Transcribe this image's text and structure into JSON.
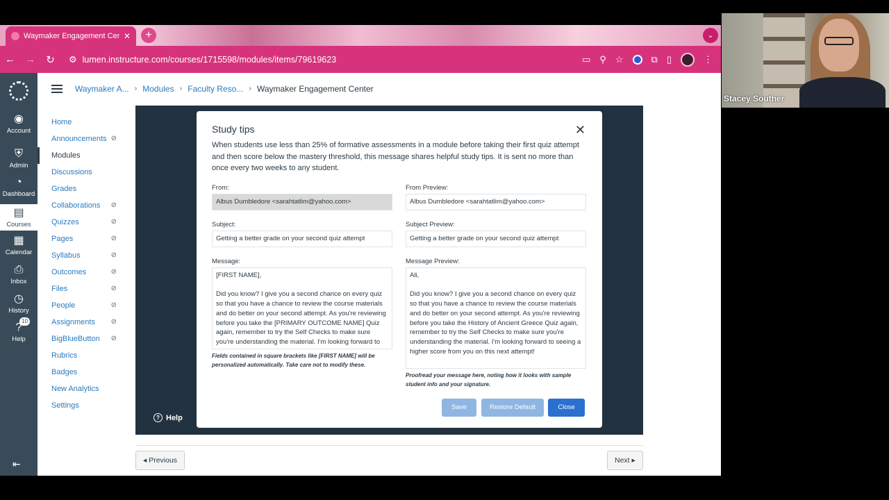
{
  "browser": {
    "tab_title": "Waymaker Engagement Cente",
    "url": "lumen.instructure.com/courses/1715598/modules/items/79619623"
  },
  "global_nav": [
    {
      "label": "Account",
      "icon": "account-icon"
    },
    {
      "label": "Admin",
      "icon": "admin-shield-icon"
    },
    {
      "label": "Dashboard",
      "icon": "dashboard-icon"
    },
    {
      "label": "Courses",
      "icon": "courses-icon"
    },
    {
      "label": "Calendar",
      "icon": "calendar-icon"
    },
    {
      "label": "Inbox",
      "icon": "inbox-icon"
    },
    {
      "label": "History",
      "icon": "history-icon"
    },
    {
      "label": "Help",
      "icon": "help-icon",
      "badge": "10"
    }
  ],
  "breadcrumb": [
    "Waymaker A...",
    "Modules",
    "Faculty Reso...",
    "Waymaker Engagement Center"
  ],
  "course_nav": [
    {
      "label": "Home"
    },
    {
      "label": "Announcements",
      "hidden": true
    },
    {
      "label": "Modules",
      "active": true
    },
    {
      "label": "Discussions"
    },
    {
      "label": "Grades"
    },
    {
      "label": "Collaborations",
      "hidden": true
    },
    {
      "label": "Quizzes",
      "hidden": true
    },
    {
      "label": "Pages",
      "hidden": true
    },
    {
      "label": "Syllabus",
      "hidden": true
    },
    {
      "label": "Outcomes",
      "hidden": true
    },
    {
      "label": "Files",
      "hidden": true
    },
    {
      "label": "People",
      "hidden": true
    },
    {
      "label": "Assignments",
      "hidden": true
    },
    {
      "label": "BigBlueButton",
      "hidden": true
    },
    {
      "label": "Rubrics"
    },
    {
      "label": "Badges"
    },
    {
      "label": "New Analytics"
    },
    {
      "label": "Settings"
    }
  ],
  "modal": {
    "title": "Study tips",
    "description": "When students use less than 25% of formative assessments in a module before taking their first quiz attempt and then score below the mastery threshold, this message shares helpful study tips. It is sent no more than once every two weeks to any student.",
    "from_label": "From:",
    "from_value": "Albus Dumbledore <sarahtatlim@yahoo.com>",
    "subject_label": "Subject:",
    "subject_value": "Getting a better grade on your second quiz attempt",
    "message_label": "Message:",
    "message_value": "[FIRST NAME],\n\nDid you know? I give you a second chance on every quiz so that you have a chance to review the course materials and do better on your second attempt. As you're reviewing before you take the [PRIMARY OUTCOME NAME] Quiz again, remember to try the Self Checks to make sure you're understanding the material. I'm looking forward to seeing a higher score from you on this next attempt!",
    "fields_note": "Fields contained in square brackets like [FIRST NAME] will be personalized automatically. Take care not to modify these.",
    "from_preview_label": "From Preview:",
    "from_preview_value": "Albus Dumbledore <sarahtatlim@yahoo.com>",
    "subject_preview_label": "Subject Preview:",
    "subject_preview_value": "Getting a better grade on your second quiz attempt",
    "message_preview_label": "Message Preview:",
    "message_preview_value": "Ali,\n\nDid you know? I give you a second chance on every quiz so that you have a chance to review the course materials and do better on your second attempt. As you're reviewing before you take the History of Ancient Greece Quiz again, remember to try the Self Checks to make sure you're understanding the material. I'm looking forward to seeing a higher score from you on this next attempt!",
    "preview_note": "Proofread your message here, noting how it looks with sample student info and your signature.",
    "save_label": "Save",
    "restore_label": "Restore Default",
    "close_label": "Close"
  },
  "help_label": "Help",
  "pager": {
    "previous": "◂ Previous",
    "next": "Next ▸"
  },
  "video": {
    "name": "Stacey Souther"
  },
  "colors": {
    "tab_pink": "#d6337c",
    "nav_dark": "#394b58",
    "link_blue": "#2b7abc",
    "primary_button": "#2b6fd1"
  }
}
